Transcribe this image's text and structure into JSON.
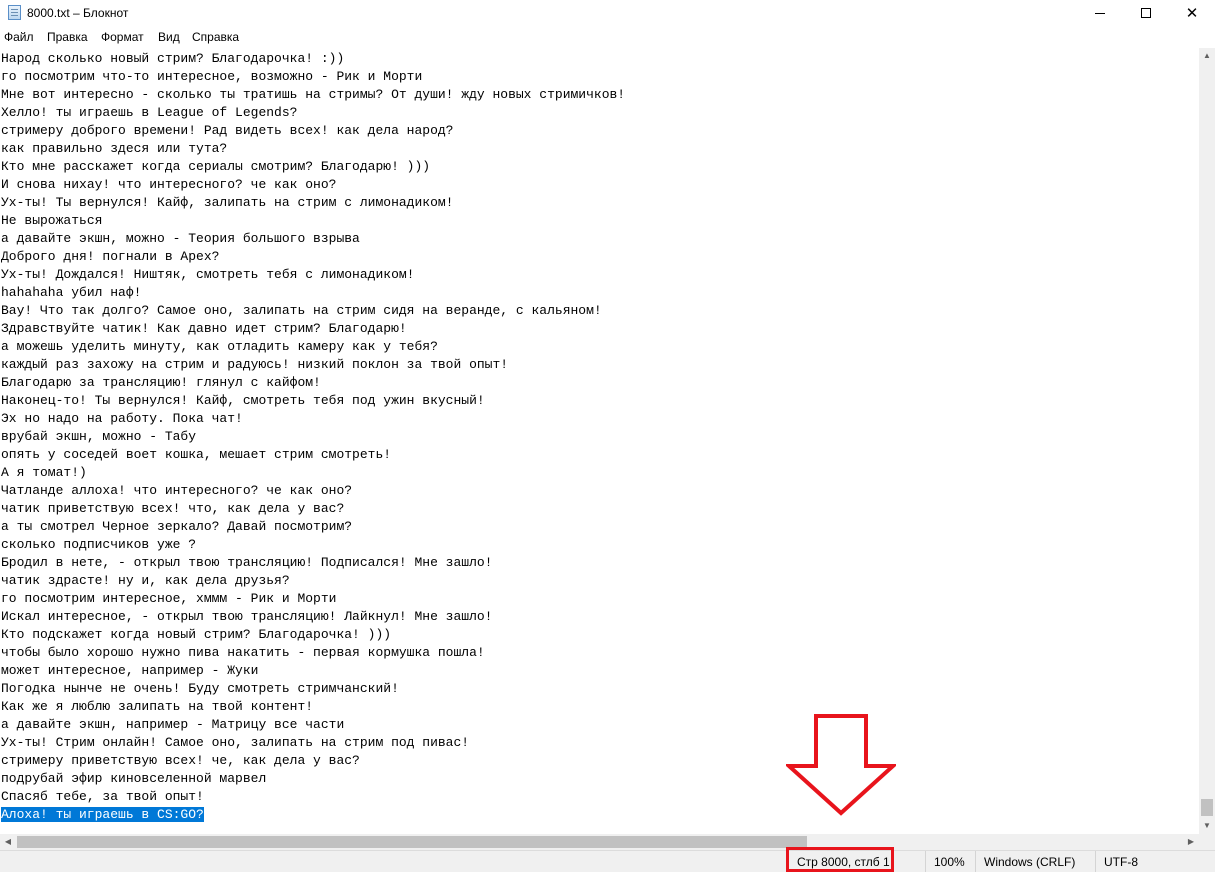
{
  "window": {
    "title": "8000.txt – Блокнот",
    "min_glyph": "",
    "max_glyph": "",
    "close_glyph": "✕"
  },
  "menu": [
    "Файл",
    "Правка",
    "Формат",
    "Вид",
    "Справка"
  ],
  "editor": {
    "lines": [
      "Народ сколько новый стрим? Благодарочка! :))",
      "го посмотрим что-то интересное, возможно - Рик и Морти",
      "Мне вот интересно - сколько ты тратишь на стримы? От души! жду новых стримичков!",
      "Хелло! ты играешь в League of Legends?",
      "стримеру доброго времени! Рад видеть всех! как дела народ?",
      "как правильно здеся или тута?",
      "Кто мне расскажет когда сериалы смотрим? Благодарю! )))",
      "И снова нихау! что интересного? че как оно?",
      "Ух-ты! Ты вернулся! Кайф, залипать на стрим с лимонадиком!",
      "Не вырожаться",
      "а давайте экшн, можно - Теория большого взрыва",
      "Доброго дня! погнали в Apex?",
      "Ух-ты! Дождался! Ништяк, смотреть тебя с лимонадиком!",
      "hahahaha убил наф!",
      "Вау! Что так долго? Самое оно, залипать на стрим сидя на веранде, с кальяном!",
      "Здравствуйте чатик! Как давно идет стрим? Благодарю!",
      "а можешь уделить минуту, как отладить камеру как у тебя?",
      "каждый раз захожу на стрим и радуюсь! низкий поклон за твой опыт!",
      "Благодарю за трансляцию! глянул с кайфом!",
      "Наконец-то! Ты вернулся! Кайф, смотреть тебя под ужин вкусный!",
      "Эх но надо на работу. Пока чат!",
      "врубай экшн, можно - Табу",
      "опять у соседей воет кошка, мешает стрим смотреть!",
      "А я томат!)",
      "Чатланде аллоха! что интересного? че как оно?",
      "чатик приветствую всех! что, как дела у вас?",
      "а ты смотрел Черное зеркало? Давай посмотрим?",
      "сколько подписчиков уже ?",
      "Бродил в нете, - открыл твою трансляцию! Подписался! Мне зашло!",
      "чатик здрасте! ну и, как дела друзья?",
      "го посмотрим интересное, хммм - Рик и Морти",
      "Искал интересное, - открыл твою трансляцию! Лайкнул! Мне зашло!",
      "Кто подскажет когда новый стрим? Благодарочка! )))",
      "чтобы было хорошо нужно пива накатить - первая кормушка пошла!",
      "может интересное, например - Жуки",
      "Погодка нынче не очень! Буду смотреть стримчанский!",
      "Как же я люблю залипать на твой контент!",
      "а давайте экшн, например - Матрицу все части",
      "Ух-ты! Стрим онлайн! Самое оно, залипать на стрим под пивас!",
      "стримеру приветствую всех! че, как дела у вас?",
      "подрубай эфир киновселенной марвел",
      "Спасяб тебе, за твой опыт!",
      "Алоха! ты играешь в CS:GO?"
    ],
    "selected_line_index": 42
  },
  "scrollbars": {
    "up": "▲",
    "down": "▼",
    "left": "◀",
    "right": "▶"
  },
  "status": {
    "position": "Стр 8000, стлб 1",
    "zoom": "100%",
    "line_endings": "Windows (CRLF)",
    "encoding": "UTF-8"
  },
  "colors": {
    "selection": "#0078d7",
    "annotation": "#e8141c"
  }
}
